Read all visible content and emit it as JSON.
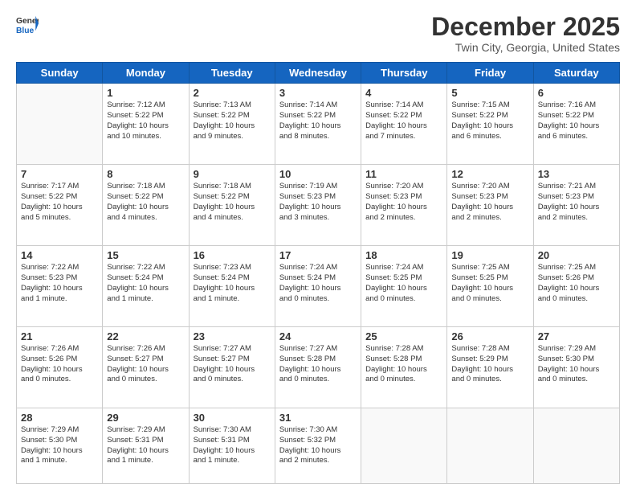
{
  "header": {
    "logo_general": "General",
    "logo_blue": "Blue",
    "month": "December 2025",
    "location": "Twin City, Georgia, United States"
  },
  "days_of_week": [
    "Sunday",
    "Monday",
    "Tuesday",
    "Wednesday",
    "Thursday",
    "Friday",
    "Saturday"
  ],
  "weeks": [
    [
      {
        "day": "",
        "info": ""
      },
      {
        "day": "1",
        "info": "Sunrise: 7:12 AM\nSunset: 5:22 PM\nDaylight: 10 hours\nand 10 minutes."
      },
      {
        "day": "2",
        "info": "Sunrise: 7:13 AM\nSunset: 5:22 PM\nDaylight: 10 hours\nand 9 minutes."
      },
      {
        "day": "3",
        "info": "Sunrise: 7:14 AM\nSunset: 5:22 PM\nDaylight: 10 hours\nand 8 minutes."
      },
      {
        "day": "4",
        "info": "Sunrise: 7:14 AM\nSunset: 5:22 PM\nDaylight: 10 hours\nand 7 minutes."
      },
      {
        "day": "5",
        "info": "Sunrise: 7:15 AM\nSunset: 5:22 PM\nDaylight: 10 hours\nand 6 minutes."
      },
      {
        "day": "6",
        "info": "Sunrise: 7:16 AM\nSunset: 5:22 PM\nDaylight: 10 hours\nand 6 minutes."
      }
    ],
    [
      {
        "day": "7",
        "info": "Sunrise: 7:17 AM\nSunset: 5:22 PM\nDaylight: 10 hours\nand 5 minutes."
      },
      {
        "day": "8",
        "info": "Sunrise: 7:18 AM\nSunset: 5:22 PM\nDaylight: 10 hours\nand 4 minutes."
      },
      {
        "day": "9",
        "info": "Sunrise: 7:18 AM\nSunset: 5:22 PM\nDaylight: 10 hours\nand 4 minutes."
      },
      {
        "day": "10",
        "info": "Sunrise: 7:19 AM\nSunset: 5:23 PM\nDaylight: 10 hours\nand 3 minutes."
      },
      {
        "day": "11",
        "info": "Sunrise: 7:20 AM\nSunset: 5:23 PM\nDaylight: 10 hours\nand 2 minutes."
      },
      {
        "day": "12",
        "info": "Sunrise: 7:20 AM\nSunset: 5:23 PM\nDaylight: 10 hours\nand 2 minutes."
      },
      {
        "day": "13",
        "info": "Sunrise: 7:21 AM\nSunset: 5:23 PM\nDaylight: 10 hours\nand 2 minutes."
      }
    ],
    [
      {
        "day": "14",
        "info": "Sunrise: 7:22 AM\nSunset: 5:23 PM\nDaylight: 10 hours\nand 1 minute."
      },
      {
        "day": "15",
        "info": "Sunrise: 7:22 AM\nSunset: 5:24 PM\nDaylight: 10 hours\nand 1 minute."
      },
      {
        "day": "16",
        "info": "Sunrise: 7:23 AM\nSunset: 5:24 PM\nDaylight: 10 hours\nand 1 minute."
      },
      {
        "day": "17",
        "info": "Sunrise: 7:24 AM\nSunset: 5:24 PM\nDaylight: 10 hours\nand 0 minutes."
      },
      {
        "day": "18",
        "info": "Sunrise: 7:24 AM\nSunset: 5:25 PM\nDaylight: 10 hours\nand 0 minutes."
      },
      {
        "day": "19",
        "info": "Sunrise: 7:25 AM\nSunset: 5:25 PM\nDaylight: 10 hours\nand 0 minutes."
      },
      {
        "day": "20",
        "info": "Sunrise: 7:25 AM\nSunset: 5:26 PM\nDaylight: 10 hours\nand 0 minutes."
      }
    ],
    [
      {
        "day": "21",
        "info": "Sunrise: 7:26 AM\nSunset: 5:26 PM\nDaylight: 10 hours\nand 0 minutes."
      },
      {
        "day": "22",
        "info": "Sunrise: 7:26 AM\nSunset: 5:27 PM\nDaylight: 10 hours\nand 0 minutes."
      },
      {
        "day": "23",
        "info": "Sunrise: 7:27 AM\nSunset: 5:27 PM\nDaylight: 10 hours\nand 0 minutes."
      },
      {
        "day": "24",
        "info": "Sunrise: 7:27 AM\nSunset: 5:28 PM\nDaylight: 10 hours\nand 0 minutes."
      },
      {
        "day": "25",
        "info": "Sunrise: 7:28 AM\nSunset: 5:28 PM\nDaylight: 10 hours\nand 0 minutes."
      },
      {
        "day": "26",
        "info": "Sunrise: 7:28 AM\nSunset: 5:29 PM\nDaylight: 10 hours\nand 0 minutes."
      },
      {
        "day": "27",
        "info": "Sunrise: 7:29 AM\nSunset: 5:30 PM\nDaylight: 10 hours\nand 0 minutes."
      }
    ],
    [
      {
        "day": "28",
        "info": "Sunrise: 7:29 AM\nSunset: 5:30 PM\nDaylight: 10 hours\nand 1 minute."
      },
      {
        "day": "29",
        "info": "Sunrise: 7:29 AM\nSunset: 5:31 PM\nDaylight: 10 hours\nand 1 minute."
      },
      {
        "day": "30",
        "info": "Sunrise: 7:30 AM\nSunset: 5:31 PM\nDaylight: 10 hours\nand 1 minute."
      },
      {
        "day": "31",
        "info": "Sunrise: 7:30 AM\nSunset: 5:32 PM\nDaylight: 10 hours\nand 2 minutes."
      },
      {
        "day": "",
        "info": ""
      },
      {
        "day": "",
        "info": ""
      },
      {
        "day": "",
        "info": ""
      }
    ]
  ]
}
